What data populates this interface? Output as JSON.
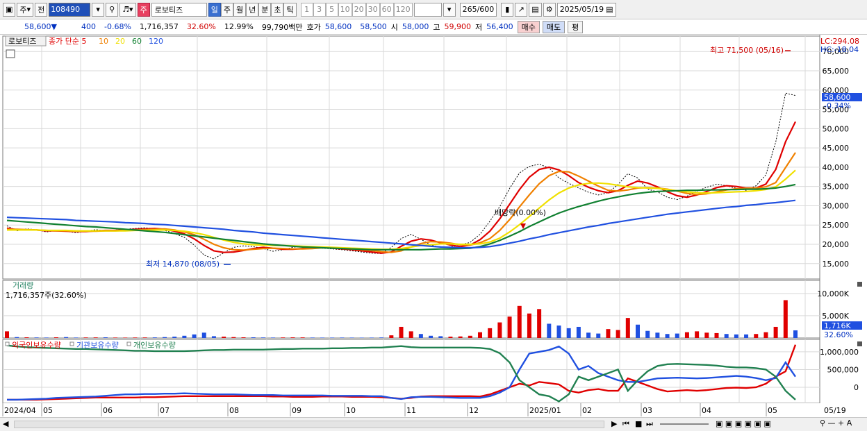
{
  "toolbar": {
    "day_select": "주",
    "prev_label": "전",
    "stock_code": "108490",
    "stock_name": "로보티즈",
    "periods": [
      "일",
      "주",
      "월",
      "년",
      "분",
      "초",
      "틱"
    ],
    "active_period": "일",
    "intervals": [
      "1",
      "3",
      "5",
      "10",
      "20",
      "30",
      "60",
      "120"
    ],
    "count": "265",
    "count_max": "/600",
    "date": "2025/05/19"
  },
  "quote": {
    "price": "58,600▼",
    "change": "400",
    "change_pct": "-0.68%",
    "volume": "1,716,357",
    "volume_ratio": "32.60%",
    "turnover": "12.99%",
    "amount": "99,790백만",
    "bid_label": "호가",
    "ask": "58,600",
    "bid": "58,500",
    "open_label": "시",
    "open": "58,000",
    "high_label": "고",
    "high": "59,900",
    "low_label": "저",
    "low": "56,400",
    "buy_label": "매수",
    "sell_label": "매도",
    "eval_label": "평"
  },
  "chart_data": {
    "type": "line",
    "price_pane": {
      "legend_name": "로보티즈",
      "legend_ma": [
        "종가 단순 5",
        "10",
        "20",
        "60",
        "120"
      ],
      "ma_colors": [
        "#e00000",
        "#f08000",
        "#f0e000",
        "#108030",
        "#2050e0"
      ],
      "ylim": [
        11000,
        74000
      ],
      "y_ticks": [
        "15,000",
        "20,000",
        "25,000",
        "30,000",
        "35,000",
        "40,000",
        "45,000",
        "50,000",
        "55,000",
        "60,000",
        "65,000",
        "70,000"
      ],
      "lc_label": "LC:294.08",
      "hc_label": "HC:-18.04",
      "last_price_label": "58,600",
      "last_change_label": "-0.34%",
      "annotations": {
        "high": "최고 71,500 (05/16)",
        "low": "최저 14,870 (08/05)",
        "dividend": "배당락(0.00%)"
      },
      "series": [
        {
          "name": "close",
          "color": "#000000",
          "values": [
            24800,
            23500,
            24000,
            23800,
            23200,
            23600,
            23400,
            23000,
            23400,
            23800,
            23500,
            23700,
            23900,
            24100,
            24300,
            24000,
            23600,
            22800,
            21800,
            19800,
            17200,
            16200,
            17800,
            19200,
            19600,
            19400,
            18900,
            18200,
            18600,
            19200,
            19500,
            19400,
            19000,
            18800,
            18600,
            18300,
            18000,
            17700,
            17600,
            19200,
            21500,
            22600,
            21300,
            19800,
            19200,
            19300,
            19800,
            20500,
            22600,
            26000,
            29800,
            34500,
            38500,
            40200,
            40800,
            39800,
            37200,
            35800,
            34600,
            33500,
            32800,
            33400,
            35500,
            38300,
            37200,
            34300,
            33600,
            32200,
            31600,
            32500,
            33800,
            34800,
            35600,
            35200,
            34500,
            34000,
            35200,
            38000,
            46500,
            59200,
            58600
          ]
        },
        {
          "name": "MA5",
          "color": "#e00000",
          "values": [
            24200,
            23800,
            23700,
            23700,
            23500,
            23500,
            23400,
            23300,
            23300,
            23500,
            23600,
            23600,
            23700,
            23900,
            24000,
            24100,
            23900,
            23400,
            22700,
            21400,
            19700,
            18300,
            17900,
            18000,
            18400,
            18900,
            19200,
            19000,
            18700,
            18700,
            18900,
            19300,
            19200,
            19000,
            18800,
            18600,
            18300,
            18000,
            17700,
            18000,
            19500,
            20800,
            21400,
            21100,
            20400,
            19800,
            19400,
            19800,
            21200,
            23400,
            26600,
            30400,
            34200,
            37400,
            39400,
            40000,
            39300,
            37800,
            36000,
            34800,
            33900,
            33400,
            33900,
            35300,
            36400,
            35900,
            34900,
            33600,
            32600,
            32200,
            32800,
            33700,
            34700,
            35200,
            35000,
            34600,
            34600,
            35600,
            39400,
            46600,
            51800
          ]
        },
        {
          "name": "MA10",
          "color": "#f08000",
          "values": [
            23900,
            23900,
            23800,
            23700,
            23600,
            23500,
            23500,
            23400,
            23400,
            23400,
            23500,
            23500,
            23600,
            23700,
            23800,
            23900,
            24000,
            23700,
            23200,
            22500,
            21300,
            20000,
            19100,
            18600,
            18500,
            18700,
            18900,
            19000,
            18900,
            18800,
            18800,
            18900,
            19100,
            19100,
            19000,
            18800,
            18600,
            18400,
            18100,
            17900,
            18300,
            19300,
            20200,
            20700,
            20600,
            20300,
            19900,
            19800,
            20400,
            21500,
            23600,
            26400,
            29700,
            32800,
            35700,
            37800,
            38900,
            38800,
            37700,
            36400,
            35100,
            34000,
            33800,
            34100,
            34600,
            34700,
            34600,
            34300,
            33800,
            33200,
            32900,
            33100,
            33600,
            34100,
            34400,
            34500,
            34600,
            34900,
            36000,
            39900,
            43800
          ]
        },
        {
          "name": "MA20",
          "color": "#f0e000",
          "values": [
            23700,
            23700,
            23700,
            23700,
            23600,
            23600,
            23600,
            23500,
            23500,
            23500,
            23500,
            23500,
            23500,
            23600,
            23600,
            23700,
            23700,
            23600,
            23400,
            23000,
            22500,
            21800,
            21100,
            20500,
            20100,
            19900,
            19800,
            19700,
            19700,
            19600,
            19500,
            19400,
            19300,
            19200,
            19100,
            19000,
            18900,
            18800,
            18700,
            18700,
            18900,
            19300,
            19700,
            19900,
            20100,
            20100,
            20000,
            20000,
            20100,
            20600,
            21600,
            23200,
            25100,
            27200,
            29400,
            31500,
            33300,
            34600,
            35400,
            35800,
            35900,
            35700,
            35300,
            34900,
            34700,
            34600,
            34500,
            34200,
            33900,
            33600,
            33400,
            33300,
            33400,
            33500,
            33600,
            33700,
            33900,
            34200,
            34900,
            36900,
            39200
          ]
        },
        {
          "name": "MA60",
          "color": "#108030",
          "values": [
            26200,
            26000,
            25800,
            25600,
            25400,
            25200,
            25000,
            24800,
            24600,
            24500,
            24300,
            24100,
            23900,
            23700,
            23500,
            23300,
            23100,
            22800,
            22500,
            22200,
            21900,
            21600,
            21300,
            21000,
            20700,
            20400,
            20100,
            19900,
            19700,
            19500,
            19300,
            19200,
            19100,
            19000,
            18900,
            18800,
            18700,
            18600,
            18600,
            18600,
            18600,
            18600,
            18600,
            18700,
            18800,
            18800,
            18900,
            19000,
            19400,
            20100,
            21000,
            22100,
            23300,
            24600,
            25800,
            27000,
            28100,
            29000,
            29800,
            30500,
            31200,
            31800,
            32300,
            32800,
            33200,
            33500,
            33700,
            33800,
            33900,
            34000,
            34000,
            34100,
            34100,
            34200,
            34200,
            34300,
            34300,
            34400,
            34600,
            35000,
            35500
          ]
        },
        {
          "name": "MA120",
          "color": "#2050e0",
          "values": [
            27000,
            26900,
            26800,
            26700,
            26600,
            26500,
            26400,
            26200,
            26100,
            26000,
            25900,
            25800,
            25600,
            25500,
            25400,
            25200,
            25100,
            24900,
            24700,
            24500,
            24300,
            24100,
            23900,
            23600,
            23400,
            23200,
            22900,
            22700,
            22500,
            22300,
            22100,
            21900,
            21700,
            21500,
            21300,
            21100,
            20900,
            20700,
            20500,
            20300,
            20100,
            19900,
            19700,
            19500,
            19300,
            19200,
            19100,
            19100,
            19200,
            19400,
            19800,
            20300,
            20800,
            21400,
            21900,
            22500,
            23000,
            23500,
            24000,
            24500,
            24900,
            25400,
            25800,
            26200,
            26600,
            27000,
            27400,
            27800,
            28100,
            28400,
            28700,
            29000,
            29300,
            29600,
            29800,
            30100,
            30300,
            30600,
            30800,
            31100,
            31400
          ]
        }
      ]
    },
    "volume_pane": {
      "title": "거래량",
      "value_label": "1,716,357주(32.60%)",
      "ylim": [
        0,
        12000
      ],
      "y_ticks": [
        "5,000K",
        "10,000K"
      ],
      "last_label": "1,716K",
      "last_pct_label": "32.60%",
      "unit": "K",
      "values": [
        1500,
        200,
        150,
        120,
        100,
        150,
        200,
        100,
        120,
        130,
        150,
        100,
        90,
        110,
        120,
        130,
        200,
        300,
        500,
        800,
        1200,
        400,
        300,
        200,
        150,
        150,
        120,
        100,
        120,
        140,
        130,
        100,
        90,
        90,
        100,
        90,
        80,
        90,
        120,
        600,
        2500,
        1500,
        900,
        500,
        400,
        300,
        350,
        500,
        1300,
        2200,
        3500,
        4800,
        7200,
        5500,
        6500,
        3200,
        2800,
        2200,
        2500,
        1200,
        1000,
        2000,
        1800,
        4500,
        3000,
        1600,
        1200,
        900,
        1000,
        1300,
        1500,
        1200,
        1100,
        900,
        800,
        800,
        900,
        1300,
        2500,
        8500,
        1716
      ],
      "volume_colors": [
        "#e00000",
        "#2050e0"
      ]
    },
    "holdings_pane": {
      "legend": [
        "외국인보유수량",
        "기관보유수량",
        "개인보유수량"
      ],
      "colors": [
        "#e00000",
        "#2050e0",
        "#208050"
      ],
      "ylim": [
        -450000,
        1350000
      ],
      "y_ticks": [
        "0",
        "500,000",
        "1,000,000"
      ],
      "series": [
        {
          "name": "외국인보유수량",
          "values": [
            -350000,
            -350000,
            -350000,
            -350000,
            -340000,
            -330000,
            -320000,
            -310000,
            -300000,
            -290000,
            -290000,
            -290000,
            -290000,
            -290000,
            -280000,
            -280000,
            -270000,
            -260000,
            -250000,
            -250000,
            -250000,
            -250000,
            -250000,
            -250000,
            -250000,
            -250000,
            -250000,
            -260000,
            -260000,
            -270000,
            -270000,
            -270000,
            -260000,
            -260000,
            -260000,
            -270000,
            -270000,
            -270000,
            -280000,
            -300000,
            -320000,
            -300000,
            -260000,
            -250000,
            -250000,
            -250000,
            -250000,
            -250000,
            -260000,
            -200000,
            -100000,
            0,
            100000,
            50000,
            150000,
            120000,
            80000,
            -100000,
            -150000,
            -80000,
            -50000,
            -100000,
            -100000,
            250000,
            150000,
            50000,
            -50000,
            -120000,
            -100000,
            -80000,
            -100000,
            -80000,
            -50000,
            -20000,
            -10000,
            -20000,
            0,
            100000,
            300000,
            450000,
            1200000
          ]
        },
        {
          "name": "기관보유수량",
          "values": [
            -350000,
            -350000,
            -340000,
            -330000,
            -320000,
            -300000,
            -290000,
            -280000,
            -270000,
            -260000,
            -240000,
            -220000,
            -200000,
            -200000,
            -190000,
            -190000,
            -180000,
            -180000,
            -170000,
            -180000,
            -190000,
            -200000,
            -200000,
            -200000,
            -210000,
            -220000,
            -220000,
            -220000,
            -230000,
            -230000,
            -230000,
            -230000,
            -230000,
            -240000,
            -240000,
            -240000,
            -240000,
            -250000,
            -250000,
            -300000,
            -330000,
            -280000,
            -270000,
            -270000,
            -280000,
            -290000,
            -300000,
            -300000,
            -300000,
            -250000,
            -150000,
            0,
            500000,
            950000,
            1000000,
            1050000,
            1150000,
            950000,
            500000,
            600000,
            400000,
            300000,
            200000,
            150000,
            150000,
            200000,
            250000,
            260000,
            270000,
            260000,
            250000,
            260000,
            280000,
            300000,
            320000,
            300000,
            260000,
            200000,
            260000,
            700000,
            300000
          ]
        },
        {
          "name": "개인보유수량",
          "values": [
            1180000,
            1150000,
            1130000,
            1120000,
            1110000,
            1100000,
            1090000,
            1080000,
            1080000,
            1070000,
            1060000,
            1050000,
            1040000,
            1030000,
            1030000,
            1020000,
            1020000,
            1020000,
            1020000,
            1030000,
            1040000,
            1050000,
            1050000,
            1060000,
            1060000,
            1060000,
            1060000,
            1070000,
            1080000,
            1080000,
            1090000,
            1090000,
            1090000,
            1100000,
            1100000,
            1110000,
            1110000,
            1120000,
            1120000,
            1140000,
            1160000,
            1130000,
            1120000,
            1120000,
            1120000,
            1120000,
            1120000,
            1120000,
            1110000,
            1080000,
            960000,
            700000,
            200000,
            0,
            -200000,
            -250000,
            -400000,
            -200000,
            300000,
            200000,
            300000,
            400000,
            500000,
            -100000,
            200000,
            450000,
            600000,
            650000,
            660000,
            650000,
            640000,
            630000,
            610000,
            580000,
            560000,
            560000,
            540000,
            500000,
            300000,
            -100000,
            -350000
          ]
        }
      ]
    },
    "x_axis": {
      "labels": [
        "2024/04",
        "05",
        "06",
        "07",
        "08",
        "09",
        "10",
        "11",
        "12",
        "2025/01",
        "02",
        "03",
        "04",
        "05"
      ],
      "right_label": "05/19"
    }
  }
}
